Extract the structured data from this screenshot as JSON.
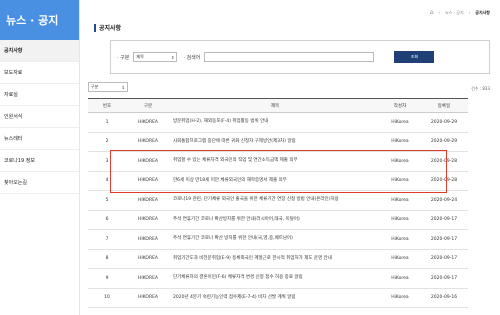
{
  "sidebar": {
    "title": "뉴스 · 공지",
    "items": [
      {
        "label": "공지사항",
        "active": true
      },
      {
        "label": "보도자료",
        "active": false
      },
      {
        "label": "자료실",
        "active": false
      },
      {
        "label": "인원서식",
        "active": false
      },
      {
        "label": "뉴스레터",
        "active": false
      },
      {
        "label": "코로나19 정보",
        "active": false
      },
      {
        "label": "찾아오는길",
        "active": false
      }
    ]
  },
  "breadcrumb": {
    "items": [
      "뉴스 · 공지",
      "공지사항"
    ]
  },
  "page": {
    "title": "공지사항"
  },
  "search": {
    "category_label": "· 구분",
    "category_value": "제목",
    "keyword_label": "· 검색어",
    "keyword_placeholder": "",
    "button_label": "조회"
  },
  "filter": {
    "value": "구분"
  },
  "count_text": "건수 : 833",
  "table": {
    "headers": [
      "번호",
      "구분",
      "제목",
      "작성자",
      "등록일"
    ],
    "rows": [
      {
        "no": "1",
        "type": "HIKOREA",
        "title": "방문취업(H-2), 재외동포(F-4) 취업활동 범위 안내",
        "author": "HiKorea",
        "date": "2020-09-29"
      },
      {
        "no": "2",
        "type": "HIKOREA",
        "title": "사회통합프로그램 중단에 따른 귀화 신청자 구제방안(제3차) 알림",
        "author": "HiKorea",
        "date": "2020-09-29"
      },
      {
        "no": "3",
        "type": "HIKOREA",
        "title": "취업할 수 있는 체류자격 외국인의 직업 및 연간소득금액 제출 의무",
        "author": "HiKorea",
        "date": "2020-09-28"
      },
      {
        "no": "4",
        "type": "HIKOREA",
        "title": "만6세 이상 만18세 미만 체류외국인의 재학증명서 제출 의무",
        "author": "HiKorea",
        "date": "2020-09-28"
      },
      {
        "no": "5",
        "type": "HIKOREA",
        "title": "코로나19 관련, 단기체류 외국인 출국을 위한 체류기간 연장 신청 방법 안내(온라인)허용",
        "author": "HiKorea",
        "date": "2020-09-24"
      },
      {
        "no": "6",
        "type": "HIKOREA",
        "title": "추석 연휴기간 코로나 확산방지를 위한 안내(러시아어,태국, 이탈어)",
        "author": "HiKorea",
        "date": "2020-09-17"
      },
      {
        "no": "7",
        "type": "HIKOREA",
        "title": "추석 연휴기간 코로나 확산 방지를 위한 안내(국,영,중,베트남어)",
        "author": "HiKorea",
        "date": "2020-09-17"
      },
      {
        "no": "8",
        "type": "HIKOREA",
        "title": "취업기간도과 비전문취업(E-9) 등록외국인 계절근로 한시적 취업허가 제도 운영 안내",
        "author": "HiKorea",
        "date": "2020-09-17"
      },
      {
        "no": "9",
        "type": "HIKOREA",
        "title": "단기체류자의 결혼이민(F-6) 체류자격 변경 신청 접수 허용 종료 알림",
        "author": "HiKorea",
        "date": "2020-09-17"
      },
      {
        "no": "10",
        "type": "HIKOREA",
        "title": "2020년 4분기 숙련기능인력 점수제(E-7-4) 비자 선발 계획 알림",
        "author": "HiKorea",
        "date": "2020-09-16"
      }
    ]
  },
  "colors": {
    "sidebar_header": "#4a90e2",
    "search_button": "#1f3f77",
    "highlight": "#e23b2e"
  }
}
